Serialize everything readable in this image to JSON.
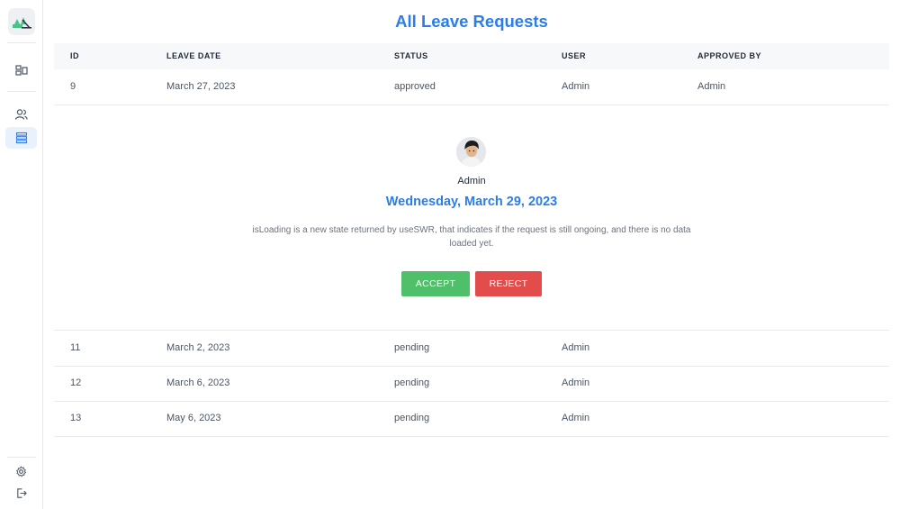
{
  "page": {
    "title": "All Leave Requests"
  },
  "table": {
    "headers": {
      "id": "ID",
      "leave_date": "LEAVE DATE",
      "status": "STATUS",
      "user": "USER",
      "approved_by": "APPROVED BY"
    },
    "rows": [
      {
        "id": "9",
        "leave_date": "March 27, 2023",
        "status": "approved",
        "user": "Admin",
        "approved_by": "Admin"
      },
      {
        "id": "11",
        "leave_date": "March 2, 2023",
        "status": "pending",
        "user": "Admin",
        "approved_by": ""
      },
      {
        "id": "12",
        "leave_date": "March 6, 2023",
        "status": "pending",
        "user": "Admin",
        "approved_by": ""
      },
      {
        "id": "13",
        "leave_date": "May 6, 2023",
        "status": "pending",
        "user": "Admin",
        "approved_by": ""
      }
    ]
  },
  "detail": {
    "user_name": "Admin",
    "date": "Wednesday, March 29, 2023",
    "description": "isLoading is a new state returned by useSWR, that indicates if the request is still ongoing, and there is no data loaded yet.",
    "accept_label": "ACCEPT",
    "reject_label": "REJECT"
  },
  "sidebar": {
    "items": [
      {
        "icon": "dashboard-icon",
        "active": false
      },
      {
        "icon": "users-icon",
        "active": false
      },
      {
        "icon": "list-icon",
        "active": true
      }
    ],
    "bottom": [
      {
        "icon": "gear-icon"
      },
      {
        "icon": "logout-icon"
      }
    ]
  },
  "colors": {
    "accent": "#2b7de9",
    "accept": "#4fbf69",
    "reject": "#e24c4a",
    "active_nav_bg": "#e9f1fc"
  }
}
